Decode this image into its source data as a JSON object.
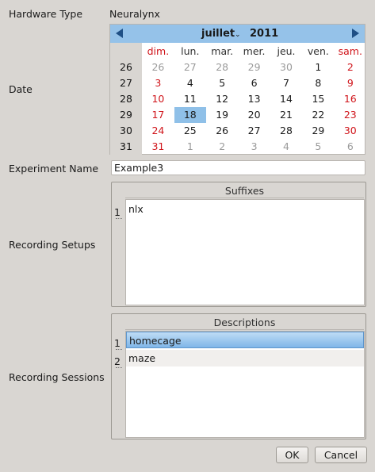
{
  "hardware_type": {
    "label": "Hardware Type",
    "value": "Neuralynx"
  },
  "date": {
    "label": "Date",
    "calendar": {
      "month": "juillet",
      "year": "2011",
      "weekdays": [
        "dim.",
        "lun.",
        "mar.",
        "mer.",
        "jeu.",
        "ven.",
        "sam."
      ],
      "weeks": [
        {
          "week": "26",
          "days": [
            "26",
            "27",
            "28",
            "29",
            "30",
            "1",
            "2"
          ]
        },
        {
          "week": "27",
          "days": [
            "3",
            "4",
            "5",
            "6",
            "7",
            "8",
            "9"
          ]
        },
        {
          "week": "28",
          "days": [
            "10",
            "11",
            "12",
            "13",
            "14",
            "15",
            "16"
          ]
        },
        {
          "week": "29",
          "days": [
            "17",
            "18",
            "19",
            "20",
            "21",
            "22",
            "23"
          ]
        },
        {
          "week": "30",
          "days": [
            "24",
            "25",
            "26",
            "27",
            "28",
            "29",
            "30"
          ]
        },
        {
          "week": "31",
          "days": [
            "31",
            "1",
            "2",
            "3",
            "4",
            "5",
            "6"
          ]
        }
      ],
      "selected_day": "18",
      "colors": {
        "header": "#95c2e9",
        "weekend": "#d0141a",
        "outside_month": "#9a9a9a",
        "selected": "#8fc0e8"
      }
    }
  },
  "experiment_name": {
    "label": "Experiment Name",
    "value": "Example3"
  },
  "recording_setups": {
    "label": "Recording Setups",
    "column_header": "Suffixes",
    "rows": [
      {
        "num": "1",
        "value": "nlx"
      }
    ]
  },
  "recording_sessions": {
    "label": "Recording Sessions",
    "column_header": "Descriptions",
    "rows": [
      {
        "num": "1",
        "value": "homecage"
      },
      {
        "num": "2",
        "value": "maze"
      }
    ]
  },
  "buttons": {
    "ok": "OK",
    "cancel": "Cancel"
  }
}
